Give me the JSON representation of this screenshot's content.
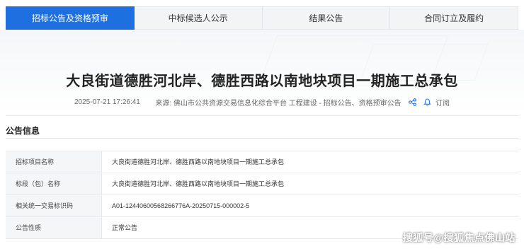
{
  "tabs": [
    {
      "label": "招标公告及资格预审",
      "active": true
    },
    {
      "label": "中标候选人公示",
      "active": false
    },
    {
      "label": "结果公告",
      "active": false
    },
    {
      "label": "合同订立及履约",
      "active": false
    }
  ],
  "article": {
    "title": "大良街道德胜河北岸、德胜西路以南地块项目一期施工总承包",
    "date": "2025-07-21 17:26:41",
    "source": "来源: 佛山市公共资源交易信息化综合平台 工程建设 - 招标公告、资格预审公告",
    "subscribe_label": "订阅"
  },
  "section": {
    "title": "公告信息"
  },
  "info_rows": [
    {
      "key": "招标项目名称",
      "value": "大良街道德胜河北岸、德胜西路以南地块项目一期施工总承包"
    },
    {
      "key": "标段（包）名称",
      "value": "大良街道德胜河北岸、德胜西路以南地块项目一期施工总承包"
    },
    {
      "key": "相关统一交易标识码",
      "value": "A01-12440600568266776A-20250715-000002-5"
    },
    {
      "key": "公告性质",
      "value": "正常公告"
    }
  ],
  "watermark": "搜狐号@搜狐焦点佛山站",
  "colors": {
    "accent": "#1e6fe0",
    "icon": "#1e6fe0"
  },
  "icons": {
    "share": "share-icon",
    "subscribe": "bell-icon"
  }
}
